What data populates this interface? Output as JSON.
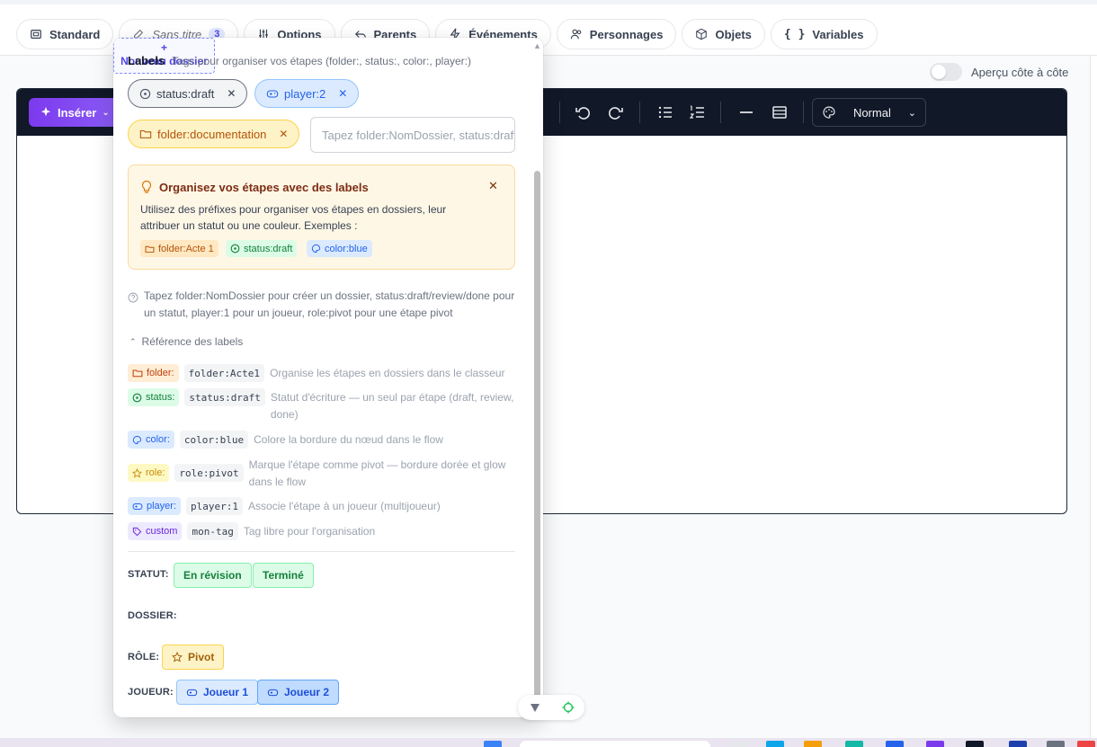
{
  "tabs": [
    {
      "label": "Standard",
      "icon": "layout-icon"
    },
    {
      "label": "Sans titre",
      "badge": "3",
      "icon": "edit-icon"
    },
    {
      "label": "Options",
      "icon": "sliders-icon"
    },
    {
      "label": "Parents",
      "icon": "reply-icon"
    },
    {
      "label": "Événements",
      "icon": "zap-icon"
    },
    {
      "label": "Personnages",
      "icon": "users-icon"
    },
    {
      "label": "Objets",
      "icon": "box-icon"
    },
    {
      "label": "Variables",
      "icon": "braces-icon"
    }
  ],
  "preview": {
    "label": "Aperçu côte à côte"
  },
  "toolbar": {
    "insert_label": "Insérer",
    "style_select": "Normal"
  },
  "popover": {
    "title": "Labels",
    "subtitle": "Tags pour organiser vos étapes (folder:, status:, color:, player:)",
    "chips": {
      "status": "status:draft",
      "player": "player:2",
      "folder": "folder:documentation"
    },
    "input_placeholder": "Tapez folder:NomDossier, status:draft…",
    "tip": {
      "title": "Organisez vos étapes avec des labels",
      "body": "Utilisez des préfixes pour organiser vos étapes en dossiers, leur attribuer un statut ou une couleur. Exemples :",
      "examples": {
        "folder": "folder:Acte 1",
        "status": "status:draft",
        "color": "color:blue"
      }
    },
    "help": "Tapez folder:NomDossier pour créer un dossier, status:draft/review/done pour un statut, player:1 pour un joueur, role:pivot pour une étape pivot",
    "reference_toggle": "Référence des labels",
    "reference": [
      {
        "tag": "folder:",
        "example": "folder:Acte1",
        "desc": "Organise les étapes en dossiers dans le classeur"
      },
      {
        "tag": "status:",
        "example": "status:draft",
        "desc": "Statut d'écriture — un seul par étape (draft, review, done)"
      },
      {
        "tag": "color:",
        "example": "color:blue",
        "desc": "Colore la bordure du nœud dans le flow"
      },
      {
        "tag": "role:",
        "example": "role:pivot",
        "desc": "Marque l'étape comme pivot — bordure dorée et glow dans le flow"
      },
      {
        "tag": "player:",
        "example": "player:1",
        "desc": "Associe l'étape à un joueur (multijoueur)"
      },
      {
        "tag": "custom",
        "example": "mon-tag",
        "desc": "Tag libre pour l'organisation"
      }
    ],
    "quick": {
      "statut_label": "STATUT:",
      "statut_buttons": [
        "En révision",
        "Terminé"
      ],
      "dossier_label": "DOSSIER:",
      "dossier_plus": "+",
      "dossier_button": "Nouveau dossier",
      "role_label": "RÔLE:",
      "role_button": "Pivot",
      "joueur_label": "JOUEUR:",
      "joueur_buttons": [
        "Joueur 1",
        "Joueur 2"
      ]
    }
  }
}
